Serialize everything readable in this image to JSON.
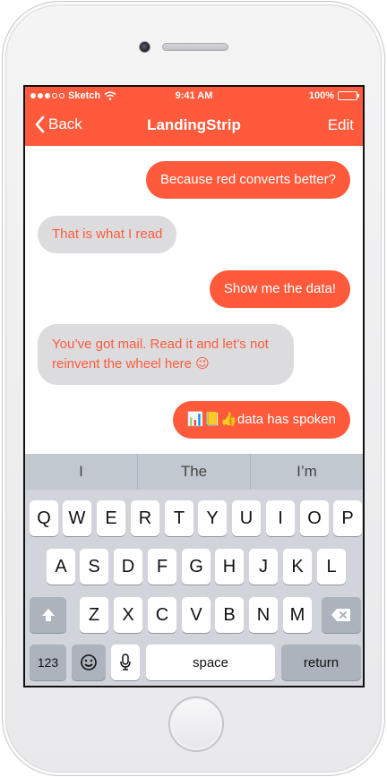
{
  "status_bar": {
    "carrier": "Sketch",
    "time": "9:41 AM",
    "battery": "100%",
    "battery_level": 1.0
  },
  "nav": {
    "back_label": "Back",
    "title": "LandingStrip",
    "edit_label": "Edit"
  },
  "messages": [
    {
      "sender": "me",
      "text": "Because red converts better?"
    },
    {
      "sender": "them",
      "text": "That is what I read"
    },
    {
      "sender": "me",
      "text": "Show me the data!"
    },
    {
      "sender": "them",
      "text": "You’ve got mail. Read it and let’s not reinvent the wheel here 😉"
    },
    {
      "sender": "me",
      "text": "📊📒👍data has spoken"
    }
  ],
  "keyboard": {
    "predictions": [
      "I",
      "The",
      "I’m"
    ],
    "row1": [
      "Q",
      "W",
      "E",
      "R",
      "T",
      "Y",
      "U",
      "I",
      "O",
      "P"
    ],
    "row2": [
      "A",
      "S",
      "D",
      "F",
      "G",
      "H",
      "J",
      "K",
      "L"
    ],
    "row3": [
      "Z",
      "X",
      "C",
      "V",
      "B",
      "N",
      "M"
    ],
    "numbers_label": "123",
    "space_label": "space",
    "return_label": "return",
    "icons": {
      "shift": "shift-arrow-icon",
      "delete": "backspace-icon",
      "emoji": "emoji-icon",
      "mic": "microphone-icon"
    }
  },
  "colors": {
    "accent": "#fe5a3b",
    "received_bubble": "#dcdcdf",
    "keyboard_bg": "#d1d5db"
  }
}
